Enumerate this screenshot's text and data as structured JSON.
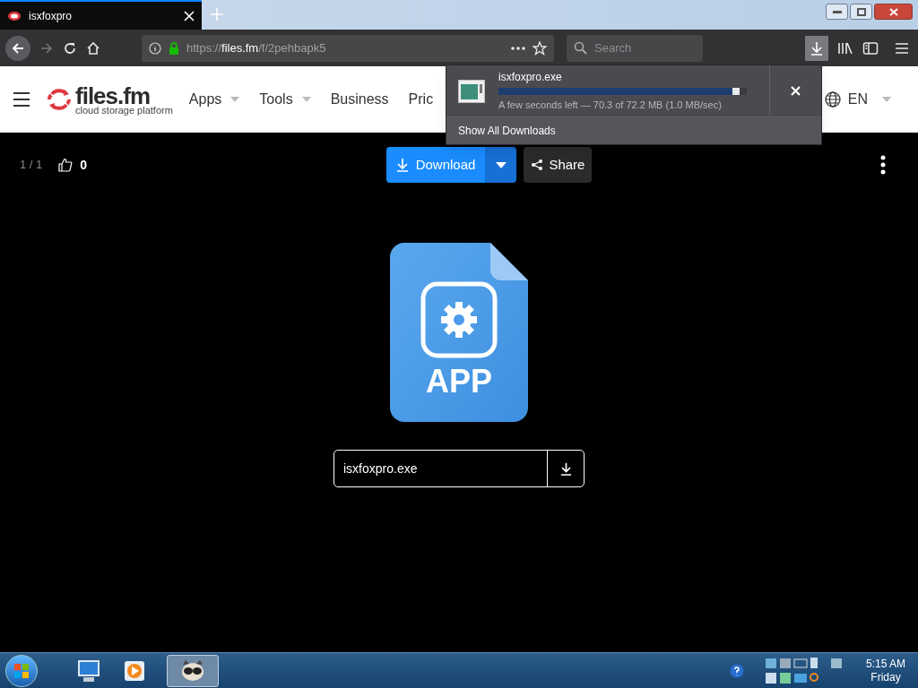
{
  "browser": {
    "tab_title": "isxfoxpro",
    "url_prefix": "https://",
    "url_domain": "files.fm",
    "url_path": "/f/2pehbapk5",
    "search_placeholder": "Search"
  },
  "site": {
    "logo_name": "files.fm",
    "logo_tagline": "cloud storage platform",
    "nav": [
      {
        "label": "Apps",
        "dropdown": true
      },
      {
        "label": "Tools",
        "dropdown": true
      },
      {
        "label": "Business",
        "dropdown": false
      },
      {
        "label": "Pric",
        "dropdown": false
      }
    ],
    "language": "EN"
  },
  "viewer": {
    "page_counter": "1 / 1",
    "likes": "0",
    "download_label": "Download",
    "share_label": "Share",
    "file_type": "APP",
    "file_name": "isxfoxpro.exe"
  },
  "downloads_panel": {
    "file_name": "isxfoxpro.exe",
    "level": 0.97,
    "status": "A few seconds left — 70.3 of 72.2 MB (1.0 MB/sec)",
    "show_all": "Show All Downloads"
  },
  "taskbar": {
    "time": "5:15 AM",
    "day": "Friday"
  }
}
